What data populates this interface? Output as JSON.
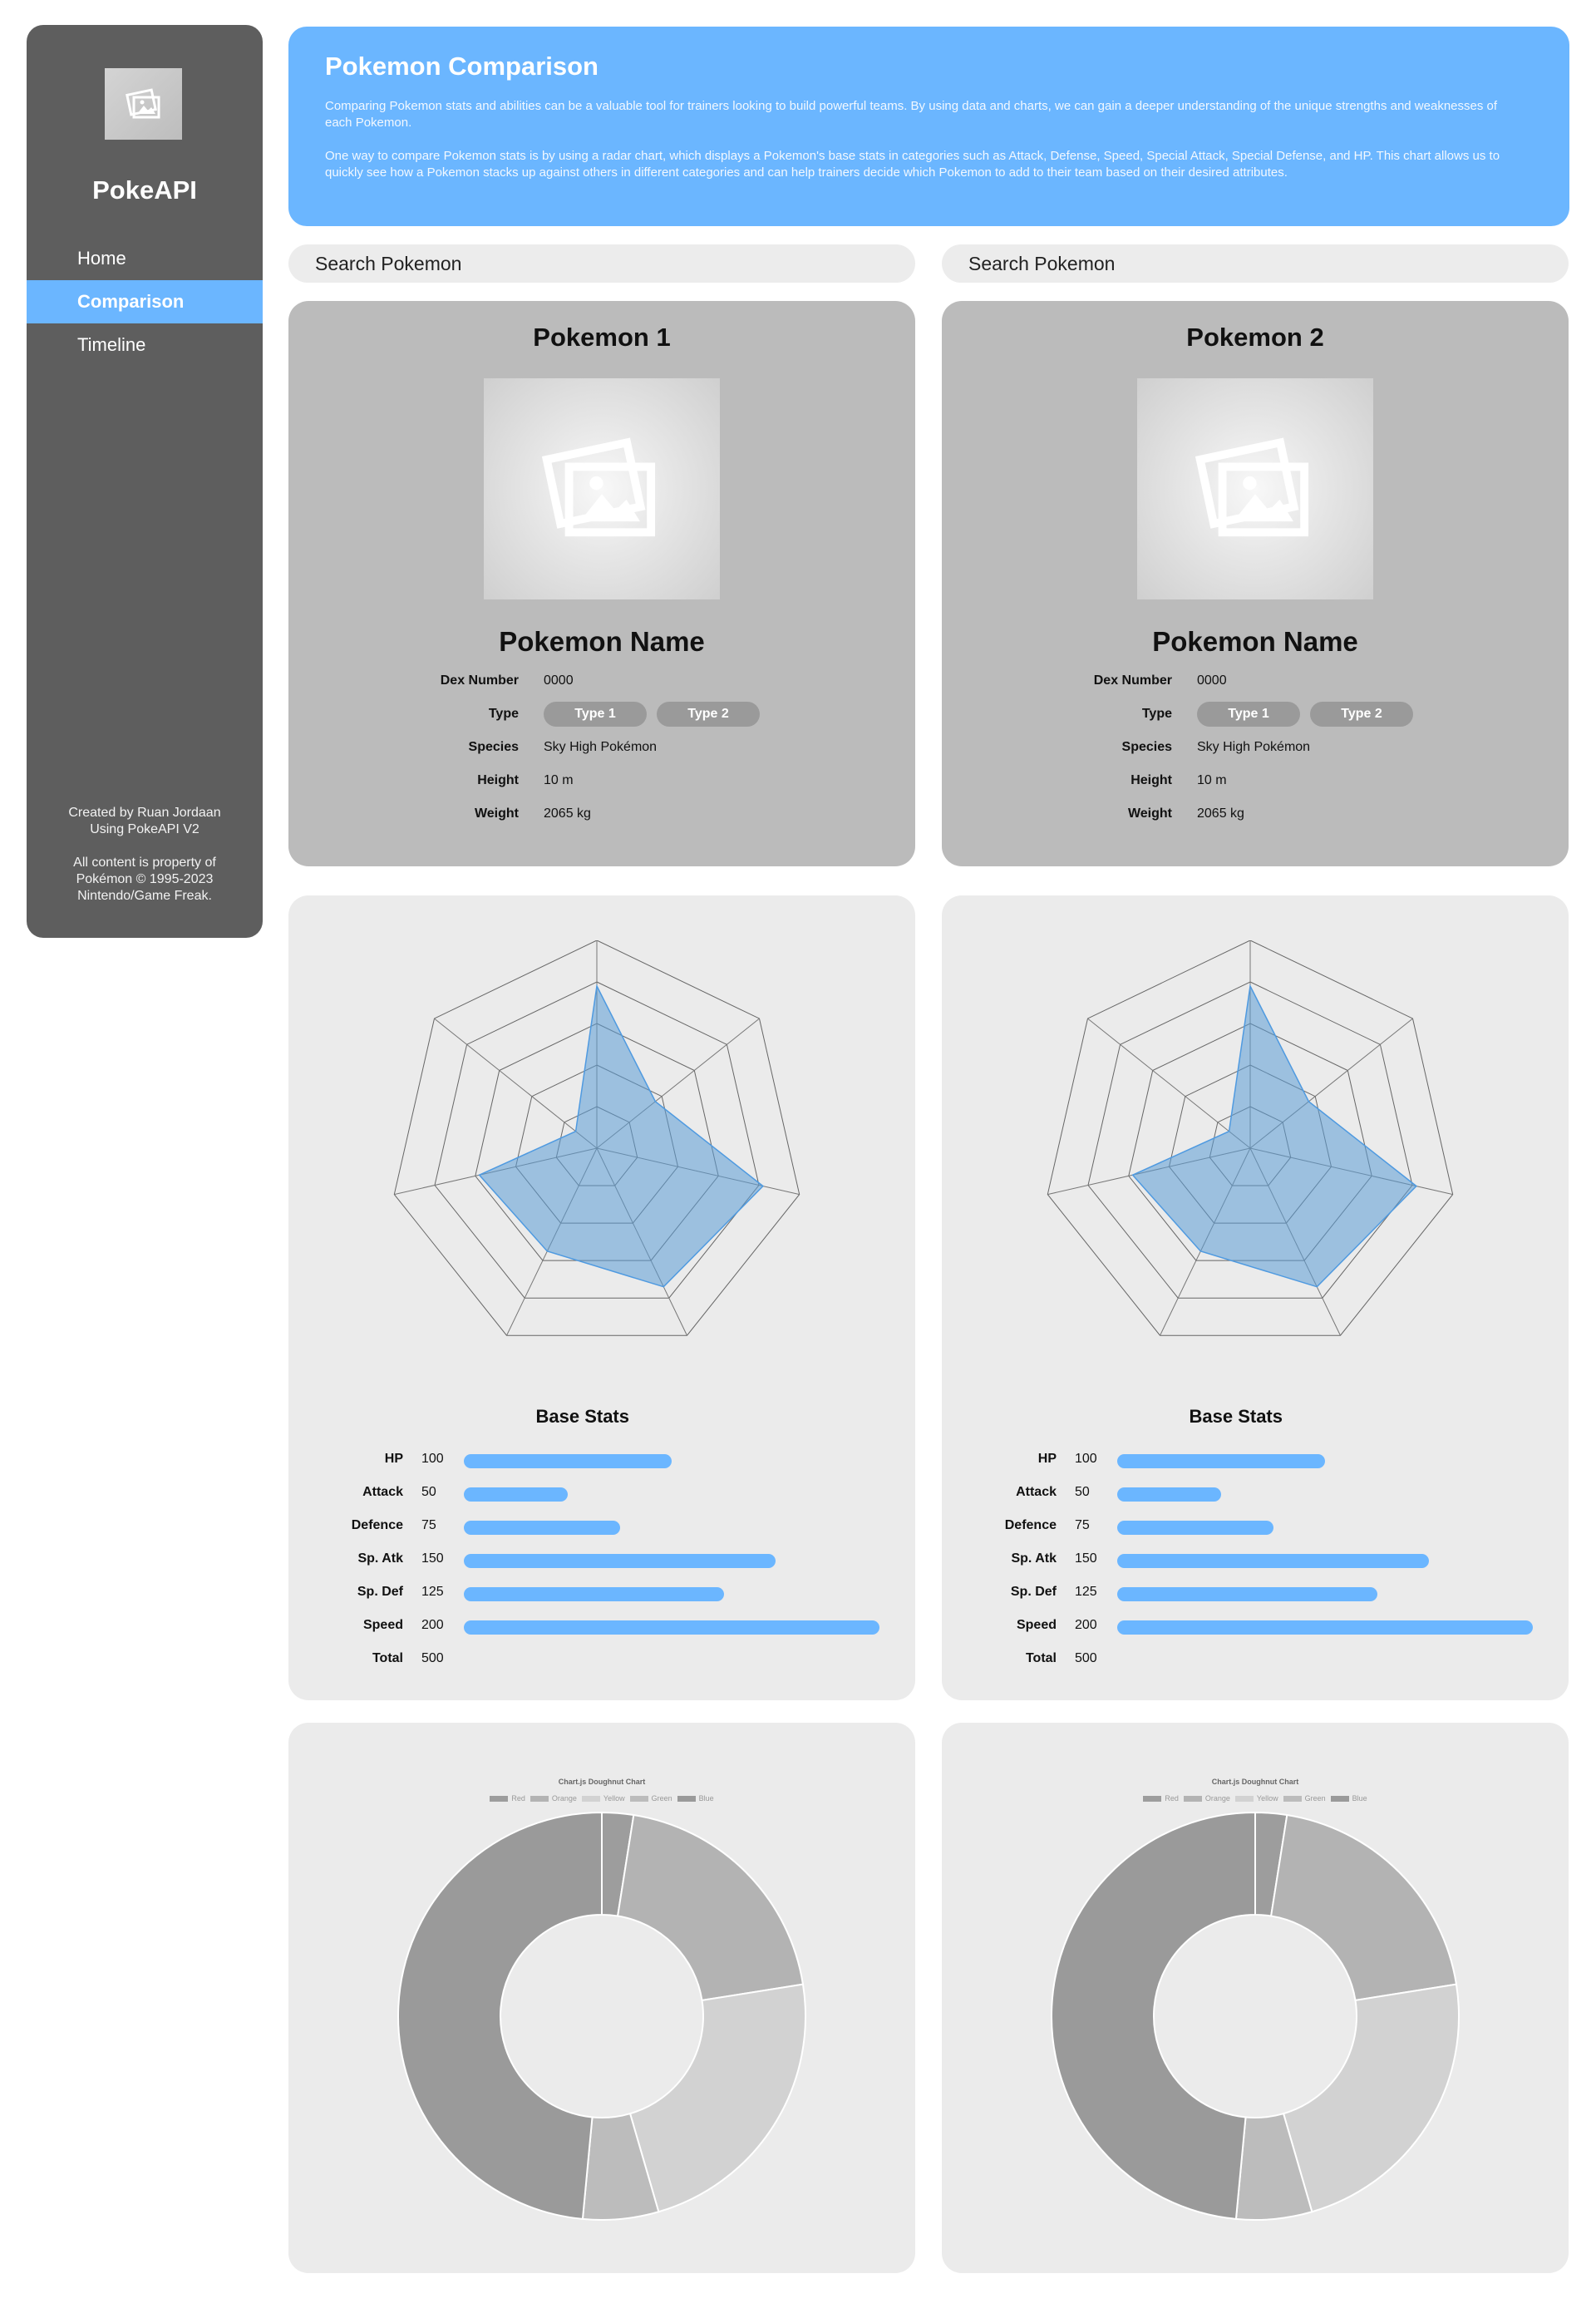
{
  "sidebar": {
    "brand": "PokeAPI",
    "nav": [
      "Home",
      "Comparison",
      "Timeline"
    ],
    "active": "Comparison",
    "footer": [
      "Created by Ruan Jordaan",
      "Using PokeAPI V2",
      "All content is property of",
      "Pokémon © 1995-2023",
      "Nintendo/Game Freak."
    ]
  },
  "header": {
    "title": "Pokemon Comparison",
    "para1": "Comparing Pokemon stats and abilities can be a valuable tool for trainers looking to build powerful teams. By using data and charts, we can gain a deeper understanding of the unique strengths and weaknesses of each Pokemon.",
    "para2": "One way to compare Pokemon stats is by using a radar chart, which displays a Pokemon's base stats in categories such as Attack, Defense, Speed, Special Attack, Special Defense, and HP. This chart allows us to quickly see how a Pokemon stacks up against others in different categories and can help trainers decide which Pokemon to add to their team based on their desired attributes."
  },
  "colors": {
    "accent": "#6bb6ff",
    "sidebar": "#5e5e5e",
    "info_card": "#bbbbbb",
    "panel": "#ebebeb"
  },
  "icons": {
    "placeholder": "image-placeholder-icon"
  },
  "pokemon": [
    {
      "search_placeholder": "Search Pokemon",
      "card_title": "Pokemon 1",
      "name": "Pokemon Name",
      "labels": {
        "dex": "Dex Number",
        "type": "Type",
        "species": "Species",
        "height": "Height",
        "weight": "Weight"
      },
      "dex": "0000",
      "types": [
        "Type 1",
        "Type 2"
      ],
      "species": "Sky High Pokémon",
      "height": "10 m",
      "weight": "2065 kg",
      "base_stats_title": "Base Stats",
      "stats": [
        {
          "label": "HP",
          "value": "100"
        },
        {
          "label": "Attack",
          "value": "50"
        },
        {
          "label": "Defence",
          "value": "75"
        },
        {
          "label": "Sp. Atk",
          "value": "150"
        },
        {
          "label": "Sp. Def",
          "value": "125"
        },
        {
          "label": "Speed",
          "value": "200"
        }
      ],
      "total_label": "Total",
      "total": "500",
      "doughnut_title": "Chart.js Doughnut Chart",
      "doughnut_legend": [
        "Red",
        "Orange",
        "Yellow",
        "Green",
        "Blue"
      ]
    },
    {
      "search_placeholder": "Search Pokemon",
      "card_title": "Pokemon 2",
      "name": "Pokemon Name",
      "labels": {
        "dex": "Dex Number",
        "type": "Type",
        "species": "Species",
        "height": "Height",
        "weight": "Weight"
      },
      "dex": "0000",
      "types": [
        "Type 1",
        "Type 2"
      ],
      "species": "Sky High Pokémon",
      "height": "10 m",
      "weight": "2065 kg",
      "base_stats_title": "Base Stats",
      "stats": [
        {
          "label": "HP",
          "value": "100"
        },
        {
          "label": "Attack",
          "value": "50"
        },
        {
          "label": "Defence",
          "value": "75"
        },
        {
          "label": "Sp. Atk",
          "value": "150"
        },
        {
          "label": "Sp. Def",
          "value": "125"
        },
        {
          "label": "Speed",
          "value": "200"
        }
      ],
      "total_label": "Total",
      "total": "500",
      "doughnut_title": "Chart.js Doughnut Chart",
      "doughnut_legend": [
        "Red",
        "Orange",
        "Yellow",
        "Green",
        "Blue"
      ]
    }
  ],
  "chart_data": [
    {
      "type": "radar",
      "axes": 7,
      "max": 1,
      "rings": 5,
      "values": [
        0.78,
        0.36,
        0.82,
        0.74,
        0.55,
        0.58,
        0.13
      ]
    },
    {
      "type": "radar",
      "axes": 7,
      "max": 1,
      "rings": 5,
      "values": [
        0.78,
        0.36,
        0.82,
        0.74,
        0.55,
        0.58,
        0.13
      ]
    },
    {
      "type": "pie",
      "title": "Chart.js Doughnut Chart",
      "categories": [
        "Red",
        "Orange",
        "Yellow",
        "Green",
        "Blue"
      ],
      "values": [
        2.5,
        20,
        23,
        6,
        48.5
      ],
      "colors": [
        "#9d9d9d",
        "#b3b3b3",
        "#d2d2d2",
        "#bcbcbc",
        "#9a9a9a"
      ]
    },
    {
      "type": "pie",
      "title": "Chart.js Doughnut Chart",
      "categories": [
        "Red",
        "Orange",
        "Yellow",
        "Green",
        "Blue"
      ],
      "values": [
        2.5,
        20,
        23,
        6,
        48.5
      ],
      "colors": [
        "#9d9d9d",
        "#b3b3b3",
        "#d2d2d2",
        "#bcbcbc",
        "#9a9a9a"
      ]
    }
  ]
}
